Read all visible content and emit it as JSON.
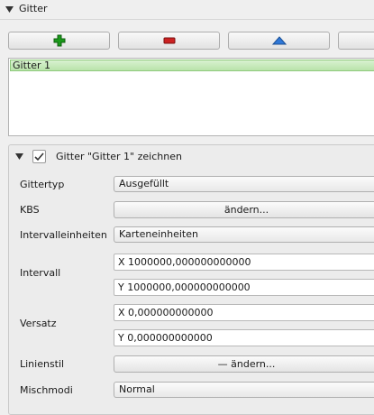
{
  "section": {
    "title": "Gitter"
  },
  "toolbar": {
    "add_icon": "plus-icon",
    "remove_icon": "minus-icon",
    "up_icon": "arrow-up-icon"
  },
  "grid_list": {
    "items": [
      "Gitter 1"
    ]
  },
  "draw_grid": {
    "checked": true,
    "title": "Gitter \"Gitter 1\" zeichnen",
    "grid_type": {
      "label": "Gittertyp",
      "value": "Ausgefüllt"
    },
    "crs": {
      "label": "KBS",
      "button": "ändern..."
    },
    "interval_units": {
      "label": "Intervalleinheiten",
      "value": "Karteneinheiten"
    },
    "interval": {
      "label": "Intervall",
      "x": "X 1000000,000000000000",
      "y": "Y 1000000,000000000000"
    },
    "offset": {
      "label": "Versatz",
      "x": "X 0,000000000000",
      "y": "Y 0,000000000000"
    },
    "line_style": {
      "label": "Linienstil",
      "button": "— ändern..."
    },
    "blend_mode": {
      "label": "Mischmodi",
      "value": "Normal"
    }
  },
  "colors": {
    "list_selection": "#b9e3aa",
    "add_green": "#1a9a1a",
    "remove_red": "#cc2222",
    "up_blue": "#2f78d8"
  }
}
